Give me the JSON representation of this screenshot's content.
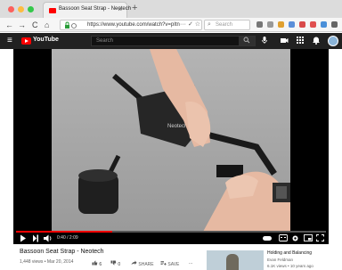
{
  "browser": {
    "tab_title": "Bassoon Seat Strap - Neotech",
    "tab_close": "×",
    "new_tab": "+",
    "url": "https://www.youtube.com/watch?v=pItn",
    "url_more": "··· ✓ ☆",
    "search_placeholder": "Search",
    "nav_back": "←",
    "nav_forward": "→",
    "nav_reload": "C",
    "nav_home": "⌂",
    "icons": [
      "back-icon",
      "forward-icon",
      "reload-icon",
      "home-icon",
      "lock-icon",
      "search-icon"
    ]
  },
  "youtube": {
    "logo_text": "YouTube",
    "search_placeholder": "Search",
    "search_button": "🔍",
    "menu": "≡",
    "colors": {
      "brand": "#ff0000",
      "header": "#212121"
    }
  },
  "player": {
    "time": "0:40 / 2:09",
    "progress": 0.31,
    "video_label": "Neotech"
  },
  "video": {
    "title": "Bassoon Seat Strap - Neotech",
    "meta": "1,448 views • Mar 20, 2014",
    "likes": "6",
    "dislikes": "0",
    "share_label": "SHARE",
    "save_label": "SAVE",
    "more_label": "..."
  },
  "recommended": {
    "title": "Holding and Balancing",
    "author": "Evan Feldman",
    "views": "6.1K views • 10 years ago"
  }
}
